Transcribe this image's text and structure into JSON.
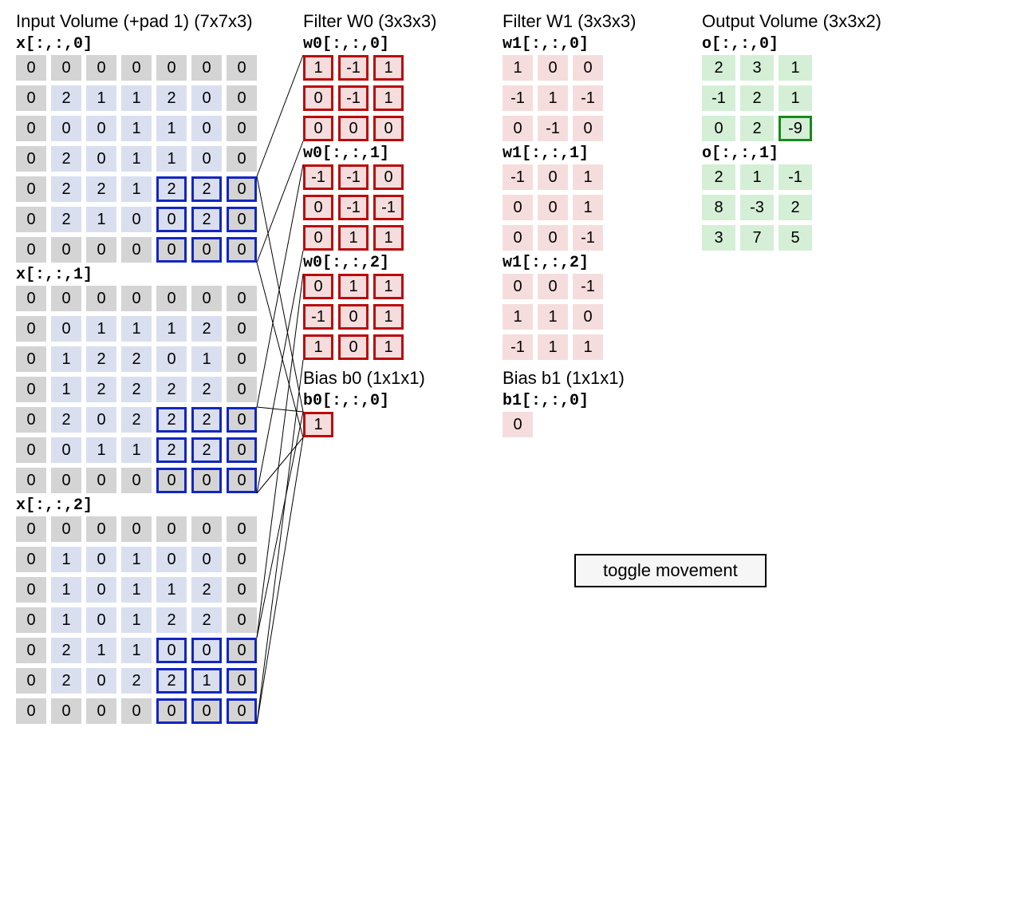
{
  "titles": {
    "input": "Input Volume (+pad 1) (7x7x3)",
    "w0": "Filter W0 (3x3x3)",
    "w1": "Filter W1 (3x3x3)",
    "output": "Output Volume (3x3x2)",
    "b0": "Bias b0 (1x1x1)",
    "b1": "Bias b1 (1x1x1)"
  },
  "labels": {
    "x0": "x[:,:,0]",
    "x1": "x[:,:,1]",
    "x2": "x[:,:,2]",
    "w00": "w0[:,:,0]",
    "w01": "w0[:,:,1]",
    "w02": "w0[:,:,2]",
    "w10": "w1[:,:,0]",
    "w11": "w1[:,:,1]",
    "w12": "w1[:,:,2]",
    "b0": "b0[:,:,0]",
    "b1": "b1[:,:,0]",
    "o0": "o[:,:,0]",
    "o1": "o[:,:,1]"
  },
  "button": "toggle movement",
  "input": {
    "highlight": {
      "row0": 4,
      "col0": 4
    },
    "x0": [
      [
        0,
        0,
        0,
        0,
        0,
        0,
        0
      ],
      [
        0,
        2,
        1,
        1,
        2,
        0,
        0
      ],
      [
        0,
        0,
        0,
        1,
        1,
        0,
        0
      ],
      [
        0,
        2,
        0,
        1,
        1,
        0,
        0
      ],
      [
        0,
        2,
        2,
        1,
        2,
        2,
        0
      ],
      [
        0,
        2,
        1,
        0,
        0,
        2,
        0
      ],
      [
        0,
        0,
        0,
        0,
        0,
        0,
        0
      ]
    ],
    "x1": [
      [
        0,
        0,
        0,
        0,
        0,
        0,
        0
      ],
      [
        0,
        0,
        1,
        1,
        1,
        2,
        0
      ],
      [
        0,
        1,
        2,
        2,
        0,
        1,
        0
      ],
      [
        0,
        1,
        2,
        2,
        2,
        2,
        0
      ],
      [
        0,
        2,
        0,
        2,
        2,
        2,
        0
      ],
      [
        0,
        0,
        1,
        1,
        2,
        2,
        0
      ],
      [
        0,
        0,
        0,
        0,
        0,
        0,
        0
      ]
    ],
    "x2": [
      [
        0,
        0,
        0,
        0,
        0,
        0,
        0
      ],
      [
        0,
        1,
        0,
        1,
        0,
        0,
        0
      ],
      [
        0,
        1,
        0,
        1,
        1,
        2,
        0
      ],
      [
        0,
        1,
        0,
        1,
        2,
        2,
        0
      ],
      [
        0,
        2,
        1,
        1,
        0,
        0,
        0
      ],
      [
        0,
        2,
        0,
        2,
        2,
        1,
        0
      ],
      [
        0,
        0,
        0,
        0,
        0,
        0,
        0
      ]
    ]
  },
  "w0": {
    "d0": [
      [
        1,
        -1,
        1
      ],
      [
        0,
        -1,
        1
      ],
      [
        0,
        0,
        0
      ]
    ],
    "d1": [
      [
        -1,
        -1,
        0
      ],
      [
        0,
        -1,
        -1
      ],
      [
        0,
        1,
        1
      ]
    ],
    "d2": [
      [
        0,
        1,
        1
      ],
      [
        -1,
        0,
        1
      ],
      [
        1,
        0,
        1
      ]
    ]
  },
  "w1": {
    "d0": [
      [
        1,
        0,
        0
      ],
      [
        -1,
        1,
        -1
      ],
      [
        0,
        -1,
        0
      ]
    ],
    "d1": [
      [
        -1,
        0,
        1
      ],
      [
        0,
        0,
        1
      ],
      [
        0,
        0,
        -1
      ]
    ],
    "d2": [
      [
        0,
        0,
        -1
      ],
      [
        1,
        1,
        0
      ],
      [
        -1,
        1,
        1
      ]
    ]
  },
  "bias": {
    "b0": 1,
    "b1": 0
  },
  "output": {
    "highlight": {
      "slice": 0,
      "row": 2,
      "col": 2
    },
    "o0": [
      [
        2,
        3,
        1
      ],
      [
        -1,
        2,
        1
      ],
      [
        0,
        2,
        -9
      ]
    ],
    "o1": [
      [
        2,
        1,
        -1
      ],
      [
        8,
        -3,
        2
      ],
      [
        3,
        7,
        5
      ]
    ]
  }
}
